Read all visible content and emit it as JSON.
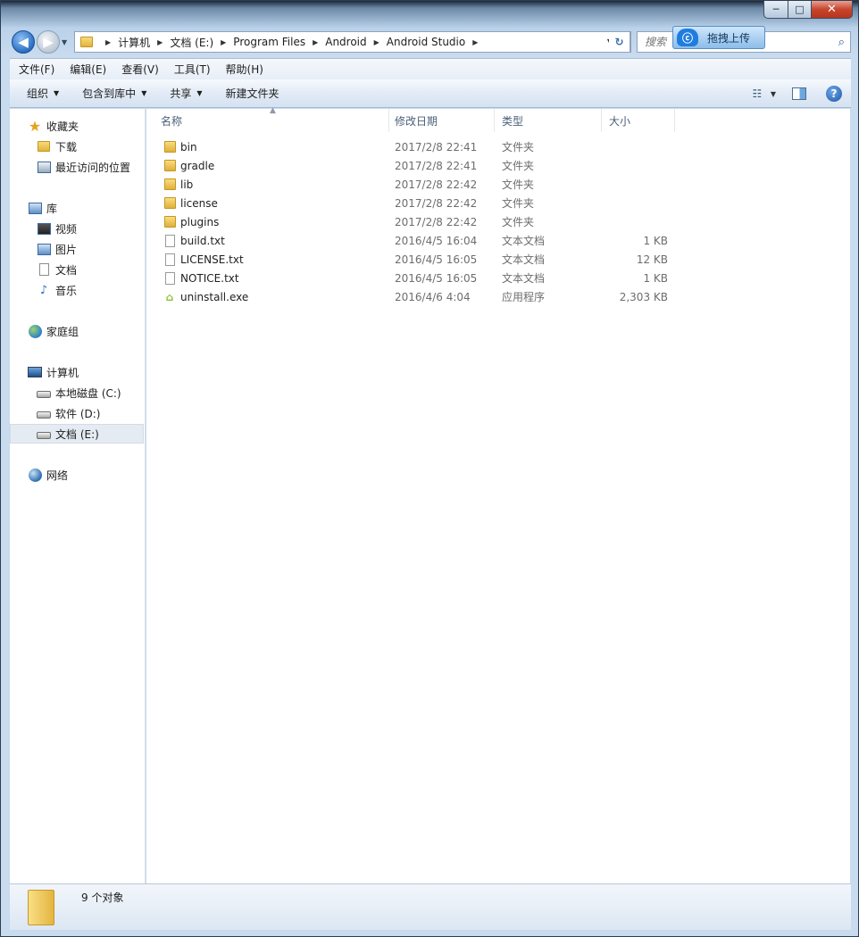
{
  "window": {
    "caption_buttons": {
      "minimize": "─",
      "maximize": "□",
      "close": "✕"
    }
  },
  "navbar": {
    "back_icon": "back-arrow-icon",
    "forward_icon": "forward-arrow-icon",
    "breadcrumbs": [
      "计算机",
      "文档 (E:)",
      "Program Files",
      "Android",
      "Android Studio"
    ],
    "search_placeholder": "搜索",
    "upload_label": "拖拽上传"
  },
  "menubar": {
    "items": [
      "文件(F)",
      "编辑(E)",
      "查看(V)",
      "工具(T)",
      "帮助(H)"
    ]
  },
  "toolbar": {
    "organize": "组织",
    "include_library": "包含到库中",
    "share": "共享",
    "new_folder": "新建文件夹"
  },
  "sidebar": {
    "favorites": {
      "label": "收藏夹",
      "items": [
        "下载",
        "最近访问的位置"
      ]
    },
    "libraries": {
      "label": "库",
      "items": [
        "视频",
        "图片",
        "文档",
        "音乐"
      ]
    },
    "homegroup": "家庭组",
    "computer": {
      "label": "计算机",
      "items": [
        "本地磁盘 (C:)",
        "软件 (D:)",
        "文档 (E:)"
      ],
      "selected": "文档 (E:)"
    },
    "network": "网络"
  },
  "columns": {
    "name": "名称",
    "date": "修改日期",
    "type": "类型",
    "size": "大小"
  },
  "files": [
    {
      "name": "bin",
      "date": "2017/2/8 22:41",
      "type": "文件夹",
      "size": "",
      "icon": "folder-icon"
    },
    {
      "name": "gradle",
      "date": "2017/2/8 22:41",
      "type": "文件夹",
      "size": "",
      "icon": "folder-icon"
    },
    {
      "name": "lib",
      "date": "2017/2/8 22:42",
      "type": "文件夹",
      "size": "",
      "icon": "folder-icon"
    },
    {
      "name": "license",
      "date": "2017/2/8 22:42",
      "type": "文件夹",
      "size": "",
      "icon": "folder-icon"
    },
    {
      "name": "plugins",
      "date": "2017/2/8 22:42",
      "type": "文件夹",
      "size": "",
      "icon": "folder-icon"
    },
    {
      "name": "build.txt",
      "date": "2016/4/5 16:04",
      "type": "文本文档",
      "size": "1 KB",
      "icon": "text-file-icon"
    },
    {
      "name": "LICENSE.txt",
      "date": "2016/4/5 16:05",
      "type": "文本文档",
      "size": "12 KB",
      "icon": "text-file-icon"
    },
    {
      "name": "NOTICE.txt",
      "date": "2016/4/5 16:05",
      "type": "文本文档",
      "size": "1 KB",
      "icon": "text-file-icon"
    },
    {
      "name": "uninstall.exe",
      "date": "2016/4/6 4:04",
      "type": "应用程序",
      "size": "2,303 KB",
      "icon": "android-icon"
    }
  ],
  "details": {
    "count": "9 个对象"
  },
  "colors": {
    "accent": "#3a6ea5",
    "selection": "#e5ebf2",
    "folder": "#e2b43a"
  }
}
